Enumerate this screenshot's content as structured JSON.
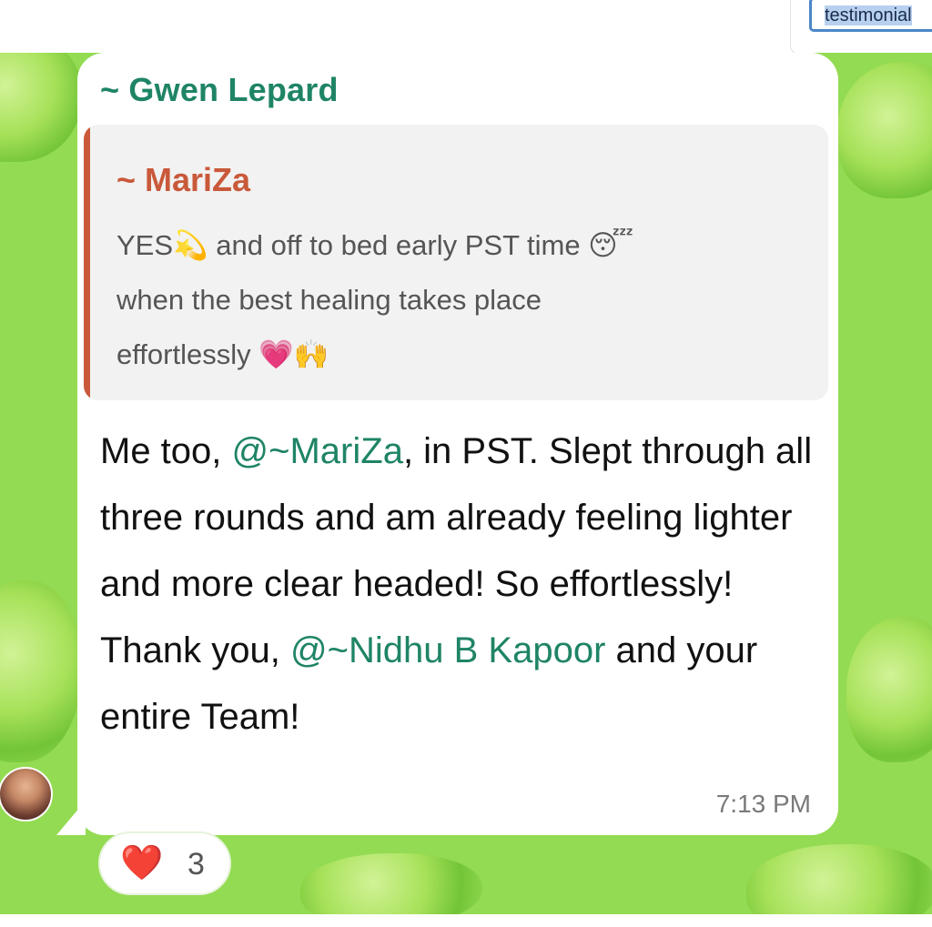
{
  "search": {
    "text": "testimonial"
  },
  "message": {
    "sender": "~ Gwen Lepard",
    "quoted": {
      "sender": "~ MariZa",
      "line1_a": "YES",
      "line1_emoji1": "💫",
      "line1_b": " and off to bed early PST time ",
      "line1_emoji2": "😴",
      "line2": "when the best healing takes place",
      "line3_a": "effortlessly ",
      "line3_emoji1": "💗",
      "line3_emoji2": "🙌"
    },
    "body": {
      "part1": "Me too, ",
      "mention1": "@~MariZa",
      "part2": ", in PST. Slept through all three rounds and am already feeling lighter and more clear headed! So effortlessly! Thank you, ",
      "mention2": "@~Nidhu B Kapoor",
      "part3": " and your entire Team!"
    },
    "time": "7:13 PM",
    "reaction": {
      "emoji": "❤️",
      "count": "3"
    }
  },
  "colors": {
    "sender": "#1f8466",
    "quote_accent": "#c9593a",
    "wallpaper": "#93db52",
    "search_border": "#4a86c8"
  },
  "icons": {
    "avatar": "user-avatar",
    "reaction": "heart-icon"
  }
}
